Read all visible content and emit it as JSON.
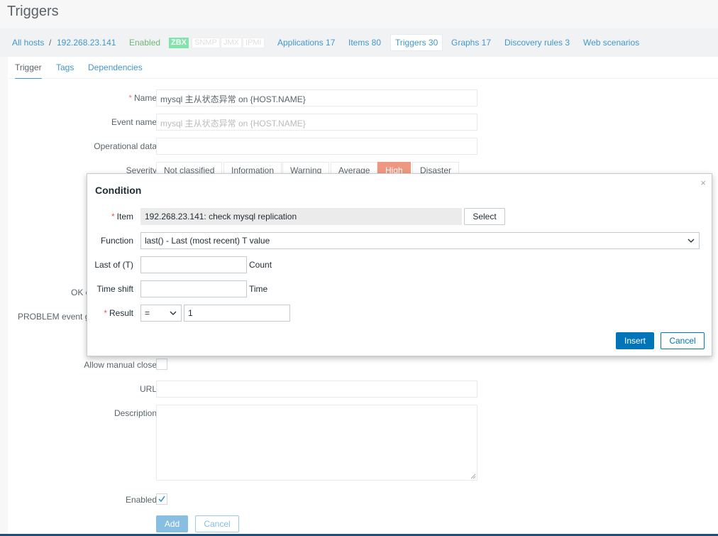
{
  "page": {
    "title": "Triggers"
  },
  "host_nav": {
    "all_hosts": "All hosts",
    "separator": "/",
    "host": "192.268.23.141",
    "status": "Enabled",
    "badges": [
      "ZBX",
      "SNMP",
      "JMX",
      "IPMI"
    ],
    "links": [
      {
        "label": "Applications 17"
      },
      {
        "label": "Items 80"
      },
      {
        "label": "Triggers 30",
        "active": true
      },
      {
        "label": "Graphs 17"
      },
      {
        "label": "Discovery rules 3"
      },
      {
        "label": "Web scenarios"
      }
    ]
  },
  "tabs": [
    "Trigger",
    "Tags",
    "Dependencies"
  ],
  "form": {
    "name_label": "Name",
    "name_value": "mysql 主从状态异常 on {HOST.NAME}",
    "event_name_label": "Event name",
    "event_name_placeholder": "mysql 主从状态异常 on {HOST.NAME}",
    "operational_data_label": "Operational data",
    "operational_data_value": "",
    "severity_label": "Severity",
    "severity_options": [
      "Not classified",
      "Information",
      "Warning",
      "Average",
      "High",
      "Disaster"
    ],
    "severity_selected": "High",
    "ok_partial_label": "OK e",
    "problem_partial_label": "PROBLEM event g",
    "allow_manual_close_label": "Allow manual close",
    "allow_manual_close_checked": false,
    "url_label": "URL",
    "url_value": "",
    "description_label": "Description",
    "description_value": "",
    "enabled_label": "Enabled",
    "enabled_checked": true,
    "add_button": "Add",
    "cancel_button": "Cancel"
  },
  "dialog": {
    "title": "Condition",
    "close_icon": "×",
    "item_label": "Item",
    "item_value": "192.268.23.141: check mysql replication",
    "select_button": "Select",
    "function_label": "Function",
    "function_value": "last() - Last (most recent) T value",
    "last_of_label": "Last of (T)",
    "last_of_value": "",
    "last_of_unit": "Count",
    "time_shift_label": "Time shift",
    "time_shift_value": "",
    "time_shift_unit": "Time",
    "result_label": "Result",
    "result_operator": "=",
    "result_value": "1",
    "insert_button": "Insert",
    "cancel_button": "Cancel"
  }
}
